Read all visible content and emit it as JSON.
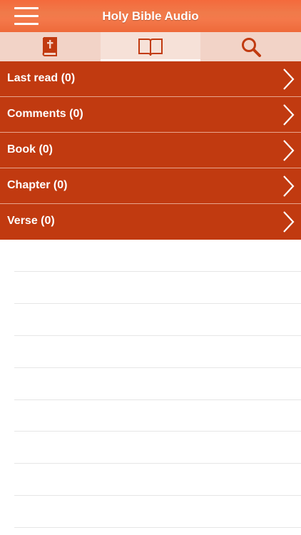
{
  "header": {
    "title": "Holy Bible Audio",
    "menu_icon": "hamburger-menu-icon"
  },
  "tabs": [
    {
      "icon": "bible-book-icon",
      "active": false
    },
    {
      "icon": "open-book-icon",
      "active": true
    },
    {
      "icon": "search-icon",
      "active": false
    }
  ],
  "list": {
    "items": [
      {
        "label": "Last read (0)"
      },
      {
        "label": "Comments (0)"
      },
      {
        "label": "Book (0)"
      },
      {
        "label": "Chapter (0)"
      },
      {
        "label": "Verse (0)"
      }
    ]
  },
  "colors": {
    "header": "#f4794b",
    "tabbar": "#f2d3c7",
    "list_item": "#c13a10",
    "accent_icon": "#c13a10"
  }
}
